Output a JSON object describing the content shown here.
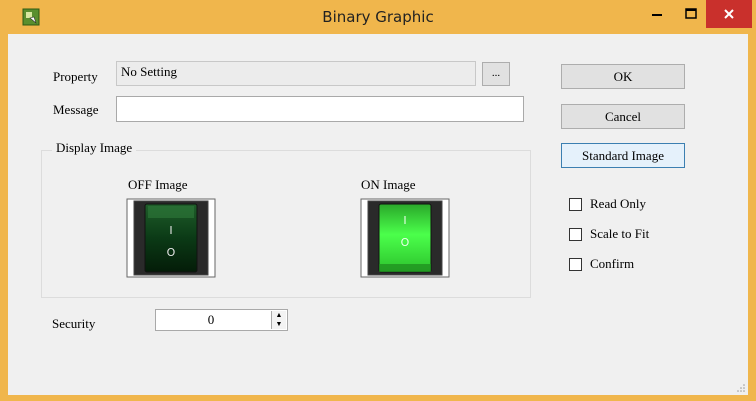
{
  "window": {
    "title": "Binary Graphic",
    "title_color": "#f0b64c",
    "close_color": "#c9302c"
  },
  "form": {
    "property_label": "Property",
    "property_value": "No Setting",
    "browse_label": "...",
    "message_label": "Message",
    "message_value": "",
    "display_group_title": "Display Image",
    "off_image_label": "OFF Image",
    "on_image_label": "ON Image",
    "switch_top_glyph": "I",
    "switch_bottom_glyph": "O",
    "security_label": "Security",
    "security_value": "0"
  },
  "buttons": {
    "ok": "OK",
    "cancel": "Cancel",
    "standard_image": "Standard Image"
  },
  "options": [
    {
      "label": "Read Only",
      "checked": false
    },
    {
      "label": "Scale to Fit",
      "checked": false
    },
    {
      "label": "Confirm",
      "checked": false
    }
  ],
  "icons": {
    "app": "binary-graphic-app-icon",
    "minimize": "minimize-icon",
    "maximize": "maximize-icon",
    "close": "close-icon"
  }
}
